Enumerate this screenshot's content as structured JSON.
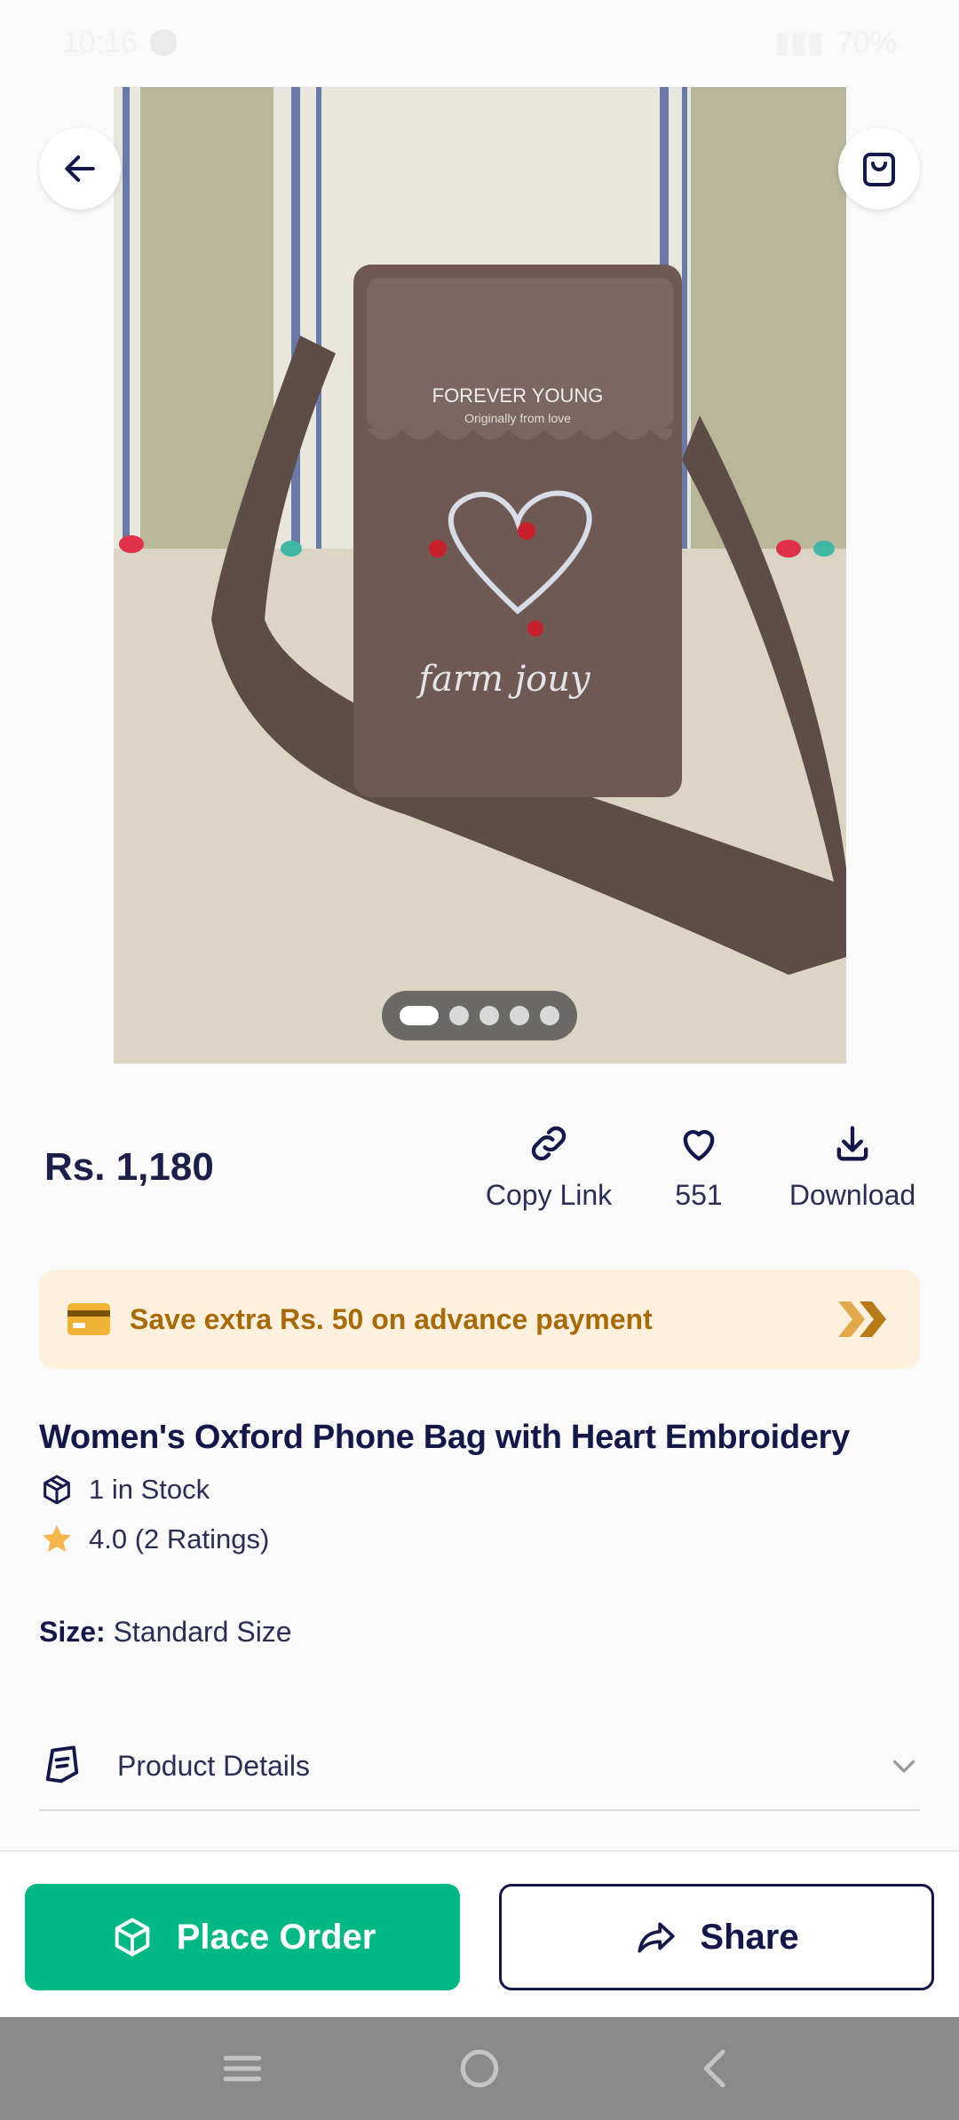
{
  "status_bar": {
    "time": "10:16",
    "battery": "70%"
  },
  "carousel": {
    "total": 5,
    "active": 1
  },
  "price": "Rs. 1,180",
  "actions": {
    "copy_link_label": "Copy Link",
    "likes_count": "551",
    "download_label": "Download"
  },
  "promo": {
    "text": "Save extra Rs. 50 on advance payment"
  },
  "product": {
    "title": "Women's Oxford Phone Bag with Heart Embroidery",
    "stock": "1 in Stock",
    "rating": "4.0 (2 Ratings)",
    "size_label": "Size:",
    "size_value": "Standard Size"
  },
  "image_text": {
    "brand_line1": "FOREVER YOUNG",
    "brand_line2": "Originally from love",
    "embroidery": "farm jouy"
  },
  "details": {
    "label": "Product Details"
  },
  "bottom_bar": {
    "place_order_label": "Place Order",
    "share_label": "Share"
  },
  "colors": {
    "accent_green": "#00b883",
    "navy": "#13174a",
    "promo_bg": "#fdf0dd",
    "promo_text": "#a86a06"
  }
}
